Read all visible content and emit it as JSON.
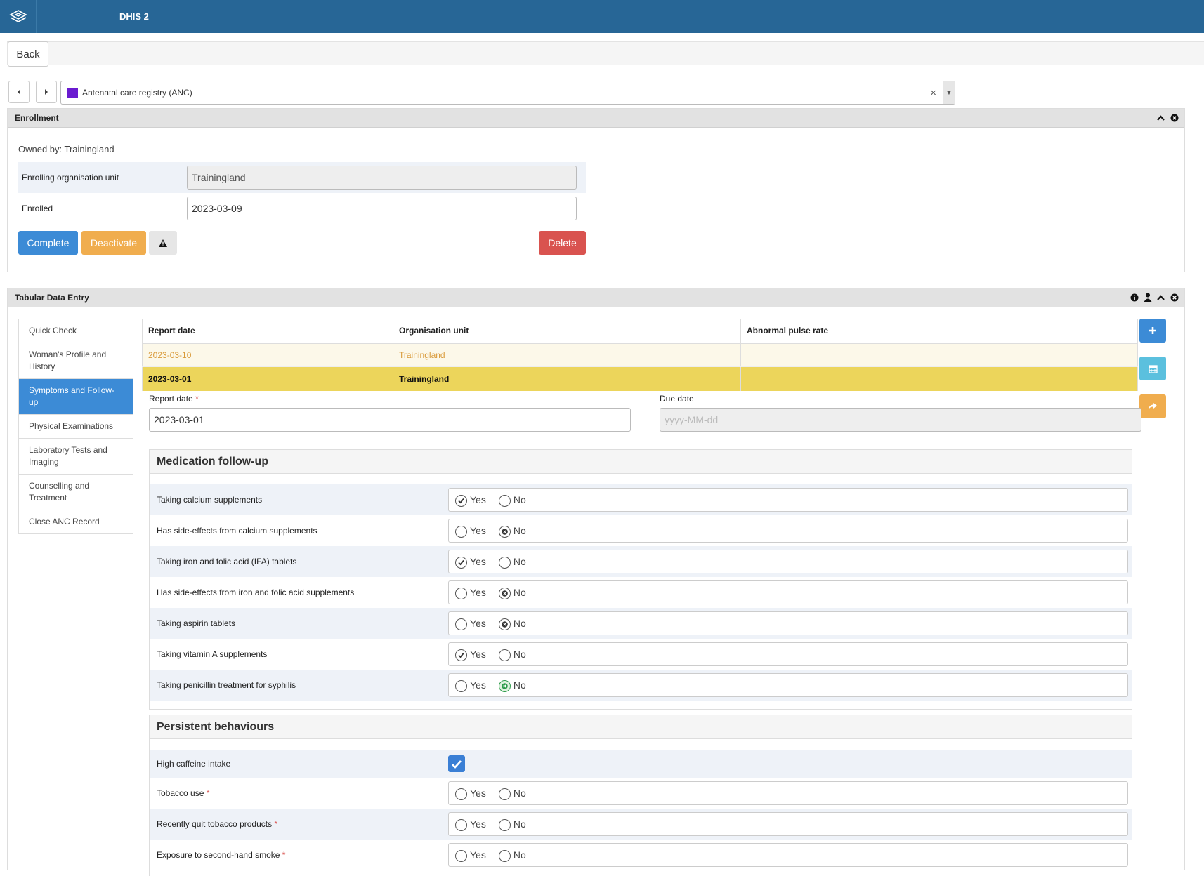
{
  "header": {
    "app_title": "DHIS 2"
  },
  "toolbar": {
    "back_label": "Back"
  },
  "program": {
    "name": "Antenatal care registry (ANC)",
    "color": "#6a1bd0",
    "clear_glyph": "×",
    "arrow_glyph": "▼"
  },
  "enrollment": {
    "title": "Enrollment",
    "owned_by": "Owned by: Trainingland",
    "org_unit_label": "Enrolling organisation unit",
    "org_unit_value": "Trainingland",
    "enrolled_label": "Enrolled",
    "enrolled_value": "2023-03-09",
    "complete_label": "Complete",
    "deactivate_label": "Deactivate",
    "delete_label": "Delete"
  },
  "tde": {
    "title": "Tabular Data Entry",
    "stages": [
      "Quick Check",
      "Woman's Profile and History",
      "Symptoms and Follow-up",
      "Physical Examinations",
      "Laboratory Tests and Imaging",
      "Counselling and Treatment",
      "Close ANC Record"
    ],
    "active_stage": "Symptoms and Follow-up",
    "columns": [
      "Report date",
      "Organisation unit",
      "Abnormal pulse rate"
    ],
    "events": [
      {
        "report_date": "2023-03-10",
        "org_unit": "Trainingland",
        "abnormal_pulse": ""
      },
      {
        "report_date": "2023-03-01",
        "org_unit": "Trainingland",
        "abnormal_pulse": ""
      }
    ],
    "report_date_label": "Report date",
    "report_date_value": "2023-03-01",
    "due_date_label": "Due date",
    "due_date_placeholder": "yyyy-MM-dd",
    "required_mark": "*",
    "yes": "Yes",
    "no": "No"
  },
  "medication": {
    "title": "Medication follow-up",
    "rows": [
      {
        "label": "Taking calcium supplements",
        "value": "Yes"
      },
      {
        "label": "Has side-effects from calcium supplements",
        "value": "No"
      },
      {
        "label": "Taking iron and folic acid (IFA) tablets",
        "value": "Yes"
      },
      {
        "label": "Has side-effects from iron and folic acid supplements",
        "value": "No"
      },
      {
        "label": "Taking aspirin tablets",
        "value": "No"
      },
      {
        "label": "Taking vitamin A supplements",
        "value": "Yes"
      },
      {
        "label": "Taking penicillin treatment for syphilis",
        "value": "No"
      }
    ]
  },
  "behaviours": {
    "title": "Persistent behaviours",
    "caffeine_label": "High caffeine intake",
    "caffeine_checked": true,
    "rows": [
      {
        "label": "Tobacco use",
        "value": ""
      },
      {
        "label": "Recently quit tobacco products",
        "value": ""
      },
      {
        "label": "Exposure to second-hand smoke",
        "value": ""
      }
    ]
  }
}
